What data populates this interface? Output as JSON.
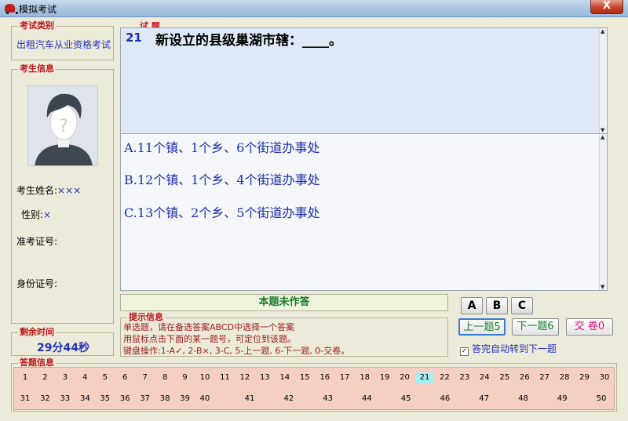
{
  "window": {
    "title": "模拟考试",
    "close_label": "X"
  },
  "exam_type": {
    "label": "考试类别",
    "value": "出租汽车从业资格考试"
  },
  "student": {
    "label": "考生信息",
    "name_label": "考生姓名:",
    "name_value": "×××",
    "gender_label": "性别:",
    "gender_value": "×",
    "admission_label": "准考证号:",
    "id_label": "身份证号:"
  },
  "remaining": {
    "label": "剩余时间",
    "value": "29分44秒"
  },
  "question": {
    "label": "试 题",
    "number": "21",
    "text": "新设立的县级巢湖市辖：____。",
    "options": [
      "A.11个镇、1个乡、6个街道办事处",
      "B.12个镇、1个乡、4个街道办事处",
      "C.13个镇、2个乡、5个街道办事处"
    ]
  },
  "status": "本题未作答",
  "hints": {
    "label": "提示信息",
    "lines": [
      "单选题，请在备选答案ABCD中选择一个答案",
      "用鼠标点击下面的某一题号，可定位到该题。",
      "键盘操作:1-A✓, 2-B×, 3-C, 5-上一题, 6-下一题, 0-交卷。"
    ]
  },
  "answer_buttons": [
    "A",
    "B",
    "C"
  ],
  "nav": {
    "prev": "上一题5",
    "next": "下一题6",
    "submit": "交 卷0"
  },
  "auto_advance": {
    "label": "答完自动转到下一题",
    "checked": true
  },
  "answer_sheet": {
    "label": "答题信息",
    "current": "21",
    "row1": [
      "1",
      "2",
      "3",
      "4",
      "5",
      "6",
      "7",
      "8",
      "9",
      "10",
      "11",
      "12",
      "13",
      "14",
      "15",
      "16",
      "17",
      "18",
      "19",
      "20",
      "21",
      "22",
      "23",
      "24",
      "25",
      "26",
      "27",
      "28",
      "29",
      "30"
    ],
    "row2": [
      "31",
      "32",
      "33",
      "34",
      "35",
      "36",
      "37",
      "38",
      "39",
      "40",
      "41",
      "42",
      "43",
      "44",
      "45",
      "46",
      "47",
      "48",
      "49",
      "50"
    ]
  }
}
